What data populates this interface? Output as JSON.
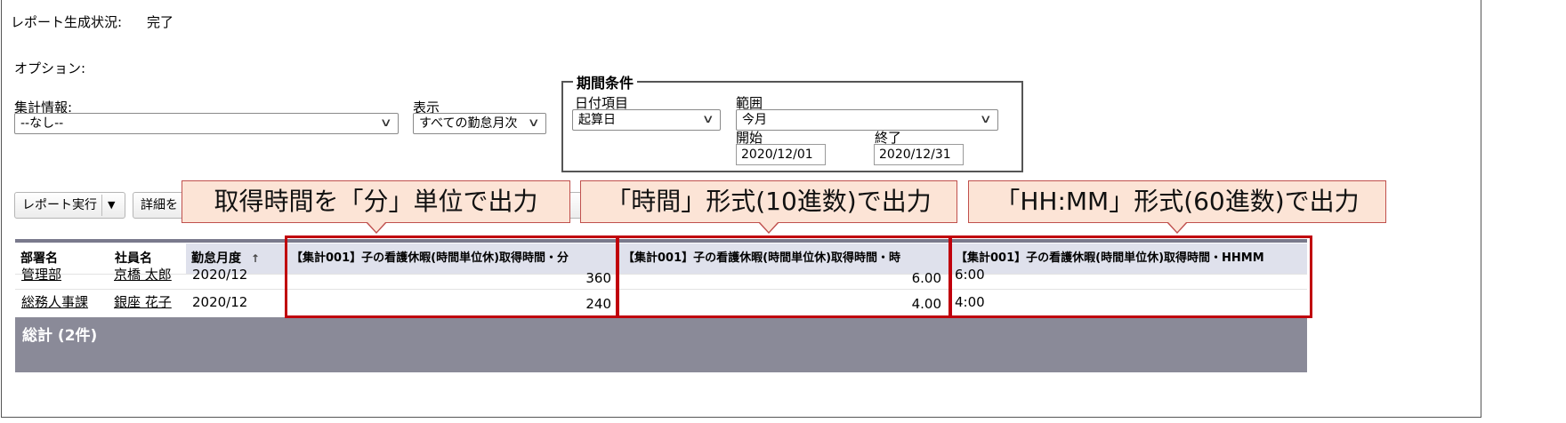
{
  "status": {
    "label": "レポート生成状況:",
    "value": "完了"
  },
  "options_label": "オプション:",
  "summary": {
    "label": "集計情報:",
    "value": "--なし--"
  },
  "display": {
    "label": "表示",
    "value": "すべての勤怠月次"
  },
  "period": {
    "legend": "期間条件",
    "date_field_label": "日付項目",
    "date_field_value": "起算日",
    "range_label": "範囲",
    "range_value": "今月",
    "start_label": "開始",
    "start_value": "2020/12/01",
    "end_label": "終了",
    "end_value": "2020/12/31"
  },
  "toolbar": {
    "run_label": "レポート実行",
    "run_dropdown_icon": "caret-down-icon",
    "detail_label": "詳細を"
  },
  "callouts": [
    "取得時間を「分」単位で出力",
    "「時間」形式(10進数)で出力",
    "「HH:MM」形式(60進数)で出力"
  ],
  "table": {
    "headers": {
      "dept": "部署名",
      "employee": "社員名",
      "month": "勤怠月度",
      "sort_icon": "↑",
      "minutes": "【集計001】子の看護休暇(時間単位休)取得時間・分",
      "hours": "【集計001】子の看護休暇(時間単位休)取得時間・時",
      "hhmm": "【集計001】子の看護休暇(時間単位休)取得時間・HHMM"
    },
    "rows": [
      {
        "dept": "管理部",
        "employee": "京橋 太郎",
        "month": "2020/12",
        "minutes": "360",
        "hours": "6.00",
        "hhmm": "6:00"
      },
      {
        "dept": "総務人事課",
        "employee": "銀座 花子",
        "month": "2020/12",
        "minutes": "240",
        "hours": "4.00",
        "hhmm": "4:00"
      }
    ],
    "total_label": "総計 (2件)"
  },
  "colors": {
    "callout_fill": "#fce4d6",
    "highlight_border": "#c0000c",
    "total_bar": "#8a8a98",
    "header_shade": "#dfe1ec"
  }
}
